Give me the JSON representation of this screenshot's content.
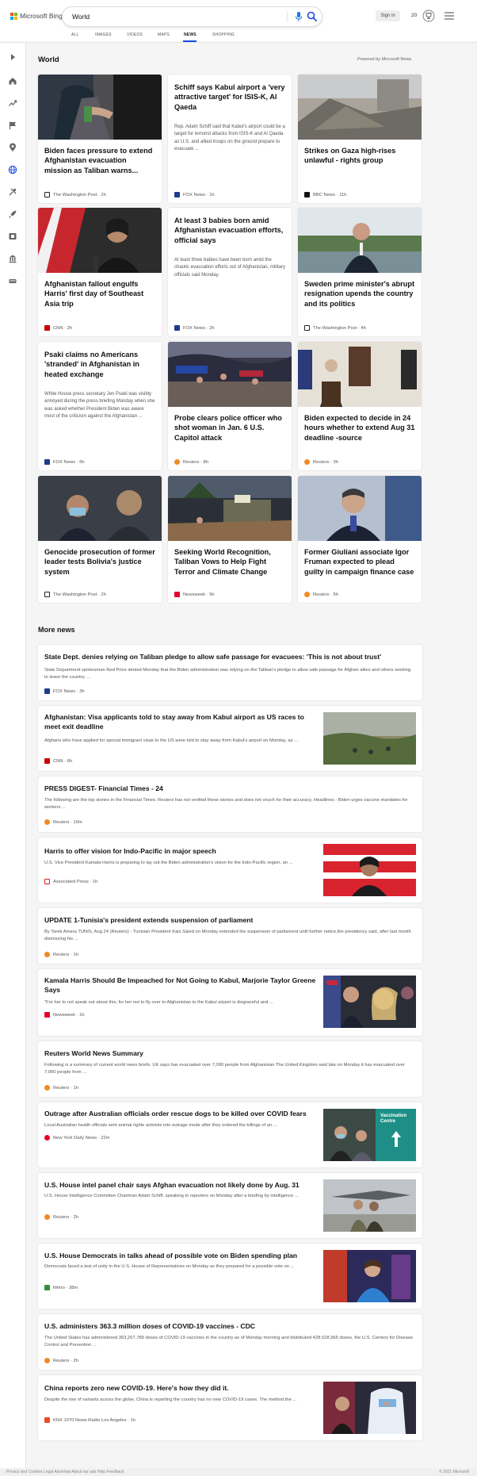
{
  "brand": {
    "name": "Microsoft Bing",
    "colors": [
      "#f25022",
      "#7fba00",
      "#00a4ef",
      "#ffb900"
    ]
  },
  "search": {
    "value": "World",
    "placeholder": ""
  },
  "header": {
    "signin_label": "Sign in",
    "rewards_count": "20"
  },
  "tabs": [
    {
      "label": "ALL"
    },
    {
      "label": "IMAGES"
    },
    {
      "label": "VIDEOS"
    },
    {
      "label": "MAPS"
    },
    {
      "label": "NEWS",
      "active": true
    },
    {
      "label": "SHOPPING"
    }
  ],
  "sidebar": {
    "icons": [
      "chevron-right-icon",
      "home-icon",
      "trending-icon",
      "flag-icon",
      "location-pin-icon",
      "globe-icon",
      "science-icon",
      "rocket-icon",
      "film-icon",
      "building-icon",
      "car-icon"
    ],
    "active": "globe-icon",
    "accent": "#174ae4"
  },
  "world": {
    "title": "World",
    "powered_by": "Powered by Microsoft News",
    "cards": [
      {
        "title": "Biden faces pressure to extend Afghanistan evacuation mission as Taliban warns...",
        "snippet": "",
        "source": "The Washington Post",
        "time": "2h",
        "image": "photo"
      },
      {
        "title": "Schiff says Kabul airport a 'very attractive target' for ISIS-K, Al Qaeda",
        "snippet": "Rep. Adam Schiff said that Kabul's airport could be a target for terrorist attacks from ISIS-K and Al Qaeda as U.S. and allied troops on the ground prepare to evacuate ...",
        "source": "FOX News",
        "time": "1h",
        "image": ""
      },
      {
        "title": "Strikes on Gaza high-rises unlawful - rights group",
        "snippet": "",
        "source": "BBC News",
        "time": "11h",
        "image": "photo"
      },
      {
        "title": "Afghanistan fallout engulfs Harris' first day of Southeast Asia trip",
        "snippet": "",
        "source": "CNN",
        "time": "2h",
        "image": "photo"
      },
      {
        "title": "At least 3 babies born amid Afghanistan evacuation efforts, official says",
        "snippet": "At least three babies have been born amid the chaotic evacuation efforts out of Afghanistan, military officials said Monday.",
        "source": "FOX News",
        "time": "2h",
        "image": ""
      },
      {
        "title": "Sweden prime minister's abrupt resignation upends the country and its politics",
        "snippet": "",
        "source": "The Washington Post",
        "time": "4h",
        "image": "photo"
      },
      {
        "title": "Psaki claims no Americans 'stranded' in Afghanistan in heated exchange",
        "snippet": "White House press secretary Jen Psaki was visibly annoyed during the press briefing Monday when she was asked whether President Biden was aware most of the criticism against the Afghanistan ...",
        "source": "FOX News",
        "time": "6h",
        "image": ""
      },
      {
        "title": "Probe clears police officer who shot woman in Jan. 6 U.S. Capitol attack",
        "snippet": "",
        "source": "Reuters",
        "time": "8h",
        "image": "photo"
      },
      {
        "title": "Biden expected to decide in 24 hours whether to extend Aug 31 deadline -source",
        "snippet": "",
        "source": "Reuters",
        "time": "3h",
        "image": "photo"
      },
      {
        "title": "Genocide prosecution of former leader tests Bolivia's justice system",
        "snippet": "",
        "source": "The Washington Post",
        "time": "2h",
        "image": "photo"
      },
      {
        "title": "Seeking World Recognition, Taliban Vows to Help Fight Terror and Climate Change",
        "snippet": "",
        "source": "Newsweek",
        "time": "5h",
        "image": "photo"
      },
      {
        "title": "Former Giuliani associate Igor Fruman expected to plead guilty in campaign finance case",
        "snippet": "",
        "source": "Reuters",
        "time": "5h",
        "image": "photo"
      }
    ]
  },
  "more_news": {
    "title": "More news",
    "items": [
      {
        "title": "State Dept. denies relying on Taliban pledge to allow safe passage for evacuees: 'This is not about trust'",
        "snippet": "State Department spokesman Ned Price denied Monday that the Biden administration was relying on the Taliban's pledge to allow safe passage for Afghan allies and others seeking to leave the country. ...",
        "source": "FOX News",
        "time": "3h"
      },
      {
        "title": "Afghanistan: Visa applicants told to stay away from Kabul airport as US races to meet exit deadline",
        "snippet": "Afghans who have applied for special immigrant visas to the US were told to stay away from Kabul's airport on Monday, as ...",
        "source": "CNN",
        "time": "6h"
      },
      {
        "title": "PRESS DIGEST- Financial Times - 24",
        "snippet": "The following are the top stories in the Financial Times. Reuters has not verified these stories and does not vouch for their accuracy. Headlines - Biden urges vaccine mandates for workers ...",
        "source": "Reuters",
        "time": "10m"
      },
      {
        "title": "Harris to offer vision for Indo-Pacific in major speech",
        "snippet": "U.S. Vice President Kamala Harris is preparing to lay out the Biden administration's vision for the Indo-Pacific region, an ...",
        "source": "Associated Press",
        "time": "1h"
      },
      {
        "title": "UPDATE 1-Tunisia's president extends suspension of parliament",
        "snippet": "By Tarek Amara TUNIS, Aug 24 (Reuters) - Tunisian President Kais Saied on Monday extended the suspension of parliament until further notice,the presidency said, after last month dismissing his ...",
        "source": "Reuters",
        "time": "1h"
      },
      {
        "title": "Kamala Harris Should Be Impeached for Not Going to Kabul, Marjorie Taylor Greene Says",
        "snippet": "\"For her to not speak out about this, for her not to fly over to Afghanistan to the Kabul airport is disgraceful and ...",
        "source": "Newsweek",
        "time": "1h"
      },
      {
        "title": "Reuters World News Summary",
        "snippet": "Following is a summary of current world news briefs. UK says has evacuated over 7,000 people from Afghanistan The United Kingdom said late on Monday it has evacuated over 7,000 people from ...",
        "source": "Reuters",
        "time": "1h"
      },
      {
        "title": "Outrage after Australian officials order rescue dogs to be killed over COVID fears",
        "snippet": "Local Australian health officials sent animal rights activists into outrage mode after they ordered the killings of an ...",
        "source": "New York Daily News",
        "time": "22m",
        "thumb_text": "Vaccination Centre"
      },
      {
        "title": "U.S. House intel panel chair says Afghan evacuation not likely done by Aug. 31",
        "snippet": "U.S. House Intelligence Committee Chairman Adam Schiff, speaking to reporters on Monday after a briefing by intelligence ...",
        "source": "Reuters",
        "time": "2h"
      },
      {
        "title": "U.S. House Democrats in talks ahead of possible vote on Biden spending plan",
        "snippet": "Democrats faced a test of unity in the U.S. House of Representatives on Monday as they prepared for a possible vote on ...",
        "source": "Metro",
        "time": "38m"
      },
      {
        "title": "U.S. administers 363.3 million doses of COVID-19 vaccines - CDC",
        "snippet": "The United States has administered 363,267,789 doses of COVID-19 vaccines in the country as of Monday morning and distributed 428,528,965 doses, the U.S. Centers for Disease Control and Prevention ...",
        "source": "Reuters",
        "time": "2h"
      },
      {
        "title": "China reports zero new COVID-19. Here's how they did it.",
        "snippet": "Despite the rise of variants across the globe, China is reporting the country has no new COVID-19 cases. The method the ...",
        "source": "KNX 1070 News Radio Los Angeles",
        "time": "1h"
      }
    ]
  },
  "source_colors": {
    "The Washington Post": "#222222",
    "FOX News": "#1c3d8a",
    "BBC News": "#111111",
    "CNN": "#cc0000",
    "Reuters": "#f08a24",
    "Newsweek": "#e4002b",
    "Associated Press": "#e11a1a",
    "New York Daily News": "#e4002b",
    "Metro": "#2f8f3a",
    "KNX 1070 News Radio Los Angeles": "#f04a24"
  },
  "footer": {
    "left": "Privacy and Cookies  Legal  Advertise  About our ads  Help  Feedback",
    "right": "© 2021 Microsoft"
  }
}
